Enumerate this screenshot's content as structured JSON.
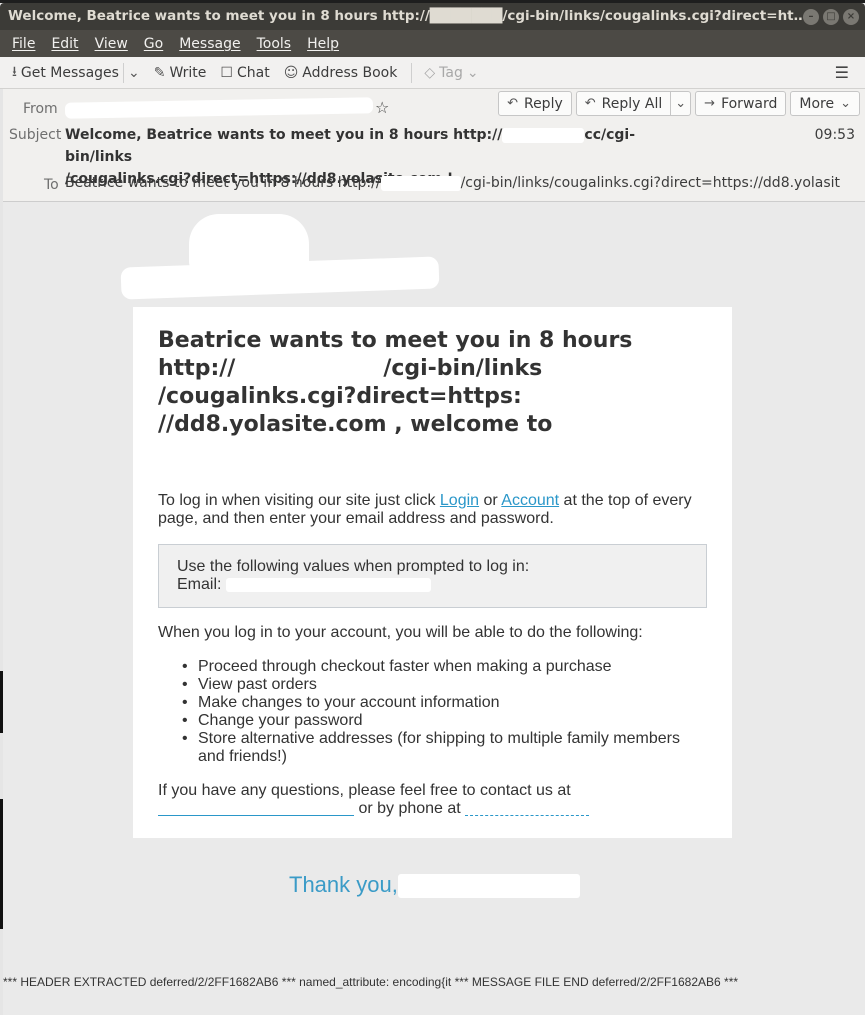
{
  "window": {
    "title": "Welcome, Beatrice wants to meet you in 8 hours http://███████/cgi-bin/links/cougalinks.cgi?direct=https...",
    "controls": {
      "minimize": "–",
      "maximize": "□",
      "close": "×"
    }
  },
  "menubar": {
    "items": [
      "File",
      "Edit",
      "View",
      "Go",
      "Message",
      "Tools",
      "Help"
    ]
  },
  "toolbar": {
    "get_messages": "Get Messages",
    "write": "Write",
    "chat": "Chat",
    "address_book": "Address Book",
    "tag": "Tag",
    "icons": {
      "get_messages": "⭳",
      "dropdown": "⌄",
      "write": "✎",
      "chat": "☐",
      "address_book": "☺",
      "tag": "◇",
      "menu": "☰"
    }
  },
  "header": {
    "from_label": "From",
    "subject_label": "Subject",
    "to_label": "To",
    "subject_part1": "Welcome, Beatrice wants to meet you in 8 hours http://",
    "subject_part2": "cc/cgi-bin/links",
    "subject_part3": "/cougalinks.cgi?direct=https://dd8.yolasite.com !",
    "time": "09:53",
    "to_part1": "Beatrice wants to meet you in 8 hours http://",
    "to_part2": "/cgi-bin/links/cougalinks.cgi?direct=https://dd8.yolasit",
    "star_icon": "☆",
    "actions": {
      "reply": "Reply",
      "reply_all": "Reply All",
      "forward": "Forward",
      "more": "More",
      "reply_icon": "↶",
      "reply_all_icon": "↶",
      "forward_icon": "→",
      "chevron": "⌄"
    }
  },
  "email": {
    "title_line1": "Beatrice wants to meet you in 8 hours",
    "title_line2a": "http://",
    "title_line2b": "/cgi-bin/links",
    "title_line3": "/cougalinks.cgi?direct=https:",
    "title_line4": "//dd8.yolasite.com , welcome to",
    "login_text_1": "To log in when visiting our site just click ",
    "login_link": "Login",
    "login_text_2": " or ",
    "account_link": "Account",
    "login_text_3": " at the top of every page, and then enter your email address and password.",
    "cred_line1": "Use the following values when prompted to log in:",
    "cred_email_label": "Email: ",
    "benefits_intro": "When you log in to your account, you will be able to do the following:",
    "benefits": [
      "Proceed through checkout faster when making a purchase",
      "View past orders",
      "Make changes to your account information",
      "Change your password",
      "Store alternative addresses (for shipping to multiple family members and friends!)"
    ],
    "contact_text_1": "If you have any questions, please feel free to contact us at",
    "contact_text_2": " or by phone at ",
    "thanks": "Thank you,"
  },
  "footer": {
    "debug_line": "*** HEADER EXTRACTED deferred/2/2FF1682AB6 *** named_attribute: encoding{it *** MESSAGE FILE END deferred/2/2FF1682AB6 ***"
  }
}
